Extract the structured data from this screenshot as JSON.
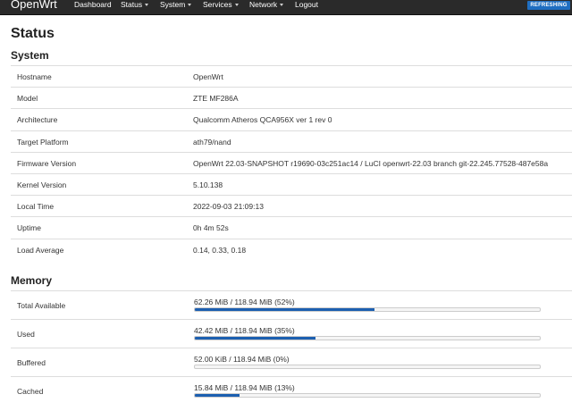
{
  "navbar": {
    "brand": "OpenWrt",
    "items": [
      {
        "label": "Dashboard",
        "dropdown": false
      },
      {
        "label": "Status",
        "dropdown": true
      },
      {
        "label": "System",
        "dropdown": true
      },
      {
        "label": "Services",
        "dropdown": true
      },
      {
        "label": "Network",
        "dropdown": true
      },
      {
        "label": "Logout",
        "dropdown": false
      }
    ],
    "badge": "REFRESHING"
  },
  "page": {
    "title": "Status"
  },
  "system": {
    "title": "System",
    "rows": [
      {
        "label": "Hostname",
        "value": "OpenWrt"
      },
      {
        "label": "Model",
        "value": "ZTE MF286A"
      },
      {
        "label": "Architecture",
        "value": "Qualcomm Atheros QCA956X ver 1 rev 0"
      },
      {
        "label": "Target Platform",
        "value": "ath79/nand"
      },
      {
        "label": "Firmware Version",
        "value": "OpenWrt 22.03-SNAPSHOT r19690-03c251ac14 / LuCI openwrt-22.03 branch git-22.245.77528-487e58a"
      },
      {
        "label": "Kernel Version",
        "value": "5.10.138"
      },
      {
        "label": "Local Time",
        "value": "2022-09-03 21:09:13"
      },
      {
        "label": "Uptime",
        "value": "0h 4m 52s"
      },
      {
        "label": "Load Average",
        "value": "0.14, 0.33, 0.18"
      }
    ]
  },
  "memory": {
    "title": "Memory",
    "rows": [
      {
        "label": "Total Available",
        "text": "62.26 MiB / 118.94 MiB (52%)",
        "percent": 52
      },
      {
        "label": "Used",
        "text": "42.42 MiB / 118.94 MiB (35%)",
        "percent": 35
      },
      {
        "label": "Buffered",
        "text": "52.00 KiB / 118.94 MiB (0%)",
        "percent": 0
      },
      {
        "label": "Cached",
        "text": "15.84 MiB / 118.94 MiB (13%)",
        "percent": 13
      }
    ]
  },
  "colors": {
    "navbar_bg": "#2a2a2a",
    "badge_bg": "#1f6ec1",
    "bar_fill": "#1c5fb0"
  }
}
